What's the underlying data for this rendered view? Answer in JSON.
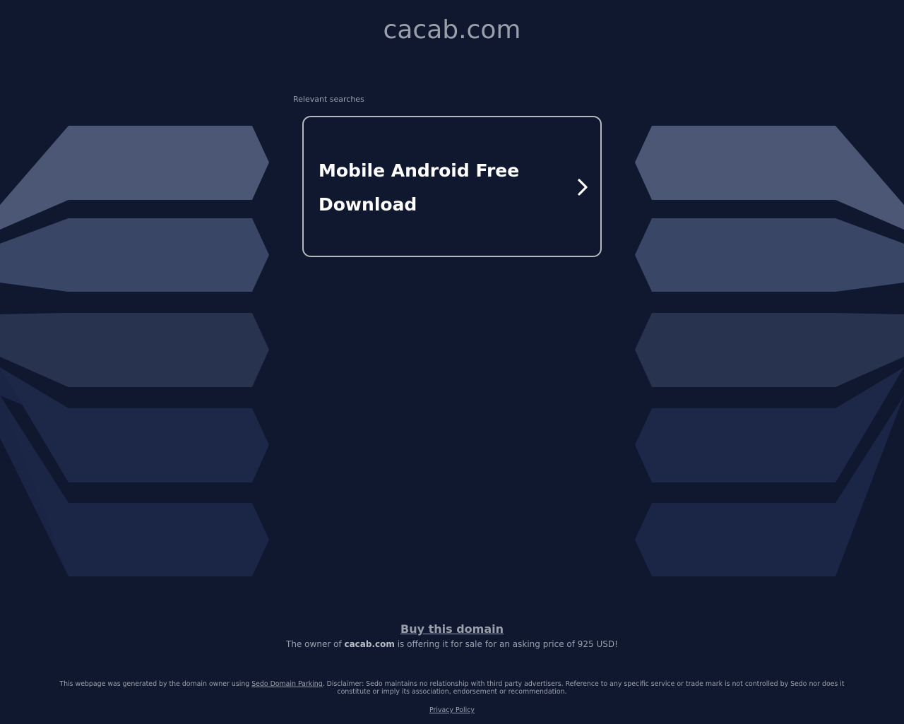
{
  "header": {
    "domain": "cacab.com"
  },
  "searches": {
    "label": "Relevant searches",
    "items": [
      {
        "text": "Mobile Android Free Download",
        "icon": "chevron-right-icon"
      }
    ]
  },
  "sale": {
    "buy_label": "Buy this domain",
    "offer_prefix": "The owner of ",
    "offer_domain": "cacab.com",
    "offer_suffix": " is offering it for sale for an asking price of 925 USD!"
  },
  "footer": {
    "disclaimer_prefix": "This webpage was generated by the domain owner using ",
    "disclaimer_link": "Sedo Domain Parking",
    "disclaimer_suffix": ". Disclaimer: Sedo maintains no relationship with third party advertisers. Reference to any specific service or trade mark is not controlled by Sedo nor does it constitute or imply its association, endorsement or recommendation.",
    "privacy_label": "Privacy Policy"
  },
  "colors": {
    "background": "#101830",
    "text_muted": "#9aa0aa",
    "card_border": "#b6b9c0",
    "band_light": "#4b5775",
    "band_dark": "#1b2647"
  }
}
